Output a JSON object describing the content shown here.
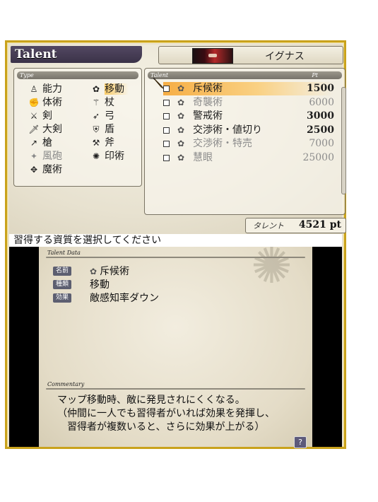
{
  "header": {
    "title": "Talent",
    "character_name": "イグナス"
  },
  "type_panel": {
    "heading": "Type",
    "items": [
      {
        "label": "能力",
        "icon": "figure-icon",
        "glyph": "♙",
        "state": "normal"
      },
      {
        "label": "移動",
        "icon": "move-icon",
        "glyph": "✿",
        "state": "selected"
      },
      {
        "label": "体術",
        "icon": "fist-icon",
        "glyph": "✊",
        "state": "normal"
      },
      {
        "label": "杖",
        "icon": "staff-icon",
        "glyph": "⚚",
        "state": "normal"
      },
      {
        "label": "剣",
        "icon": "sword-icon",
        "glyph": "⚔",
        "state": "normal"
      },
      {
        "label": "弓",
        "icon": "bow-icon",
        "glyph": "➶",
        "state": "normal"
      },
      {
        "label": "大剣",
        "icon": "greatsword-icon",
        "glyph": "🗡",
        "state": "normal"
      },
      {
        "label": "盾",
        "icon": "shield-icon",
        "glyph": "⛨",
        "state": "normal"
      },
      {
        "label": "槍",
        "icon": "spear-icon",
        "glyph": "↗",
        "state": "normal"
      },
      {
        "label": "斧",
        "icon": "axe-icon",
        "glyph": "⚒",
        "state": "normal"
      },
      {
        "label": "風砲",
        "icon": "cannon-icon",
        "glyph": "✦",
        "state": "dim"
      },
      {
        "label": "印術",
        "icon": "seal-icon",
        "glyph": "✺",
        "state": "normal"
      },
      {
        "label": "魔術",
        "icon": "magic-icon",
        "glyph": "✥",
        "state": "normal"
      }
    ]
  },
  "talent_panel": {
    "heading": "Talent",
    "pt_heading": "Pt",
    "rows": [
      {
        "name": "斥候術",
        "pt": "1500",
        "state": "selected"
      },
      {
        "name": "奇襲術",
        "pt": "6000",
        "state": "dim"
      },
      {
        "name": "警戒術",
        "pt": "3000",
        "state": "normal"
      },
      {
        "name": "交渉術・値切り",
        "pt": "2500",
        "state": "normal"
      },
      {
        "name": "交渉術・特売",
        "pt": "7000",
        "state": "dim"
      },
      {
        "name": "慧眼",
        "pt": "25000",
        "state": "dim"
      }
    ],
    "row_icon_glyph": "✿"
  },
  "points": {
    "label": "タレント",
    "value": "4521 pt"
  },
  "prompt": "習得する資質を選択してください",
  "talent_data": {
    "heading": "Talent Data",
    "name_label": "名前",
    "name_value": "斥候術",
    "type_label": "種類",
    "type_value": "移動",
    "effect_label": "効果",
    "effect_value": "敵感知率ダウン"
  },
  "commentary": {
    "heading": "Commentary",
    "lines": [
      "マップ移動時、敵に発見されにくくなる。",
      "（仲間に一人でも習得者がいれば効果を発揮し、",
      "　習得者が複数いると、さらに効果が上がる）"
    ]
  },
  "help_button": "?",
  "colors": {
    "frame_gold": "#c9a21c",
    "title_tab": "#3b3248",
    "highlight_orange": "#f6aa3c",
    "parchment": "#e9e2cf"
  }
}
